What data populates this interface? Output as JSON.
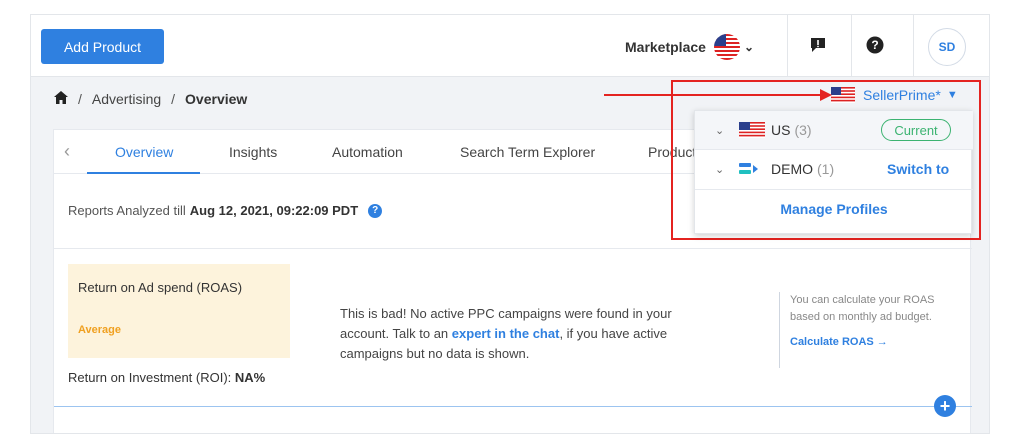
{
  "header": {
    "add_product_label": "Add Product",
    "marketplace_label": "Marketplace",
    "avatar_initials": "SD"
  },
  "breadcrumb": {
    "items": [
      "Advertising",
      "Overview"
    ],
    "separator": "/"
  },
  "account_selector": {
    "label": "SellerPrime*"
  },
  "profiles_dropdown": {
    "rows": [
      {
        "name": "US",
        "count": "(3)",
        "status": "Current"
      },
      {
        "name": "DEMO",
        "count": "(1)",
        "action": "Switch to"
      }
    ],
    "manage_label": "Manage Profiles"
  },
  "tabs": [
    "Overview",
    "Insights",
    "Automation",
    "Search Term Explorer",
    "Product"
  ],
  "reports": {
    "prefix": "Reports Analyzed till",
    "date": "Aug 12, 2021, 09:22:09 PDT",
    "help_icon": "?"
  },
  "roas": {
    "title": "Return on Ad spend (ROAS)",
    "level": "Average"
  },
  "roi": {
    "label": "Return on Investment (ROI):",
    "value": "NA%"
  },
  "message": {
    "part1": "This is bad! No active PPC campaigns were found in your account. Talk to an",
    "link": "expert in the chat",
    "part2": ", if you have active campaigns but no data is shown."
  },
  "side_note": {
    "text": "You can calculate your ROAS based on monthly ad budget.",
    "link": "Calculate ROAS →"
  },
  "colors": {
    "primary": "#2f80e0",
    "annotation_red": "#e42320",
    "current_green": "#3cb371",
    "average_orange": "#f0a020"
  }
}
